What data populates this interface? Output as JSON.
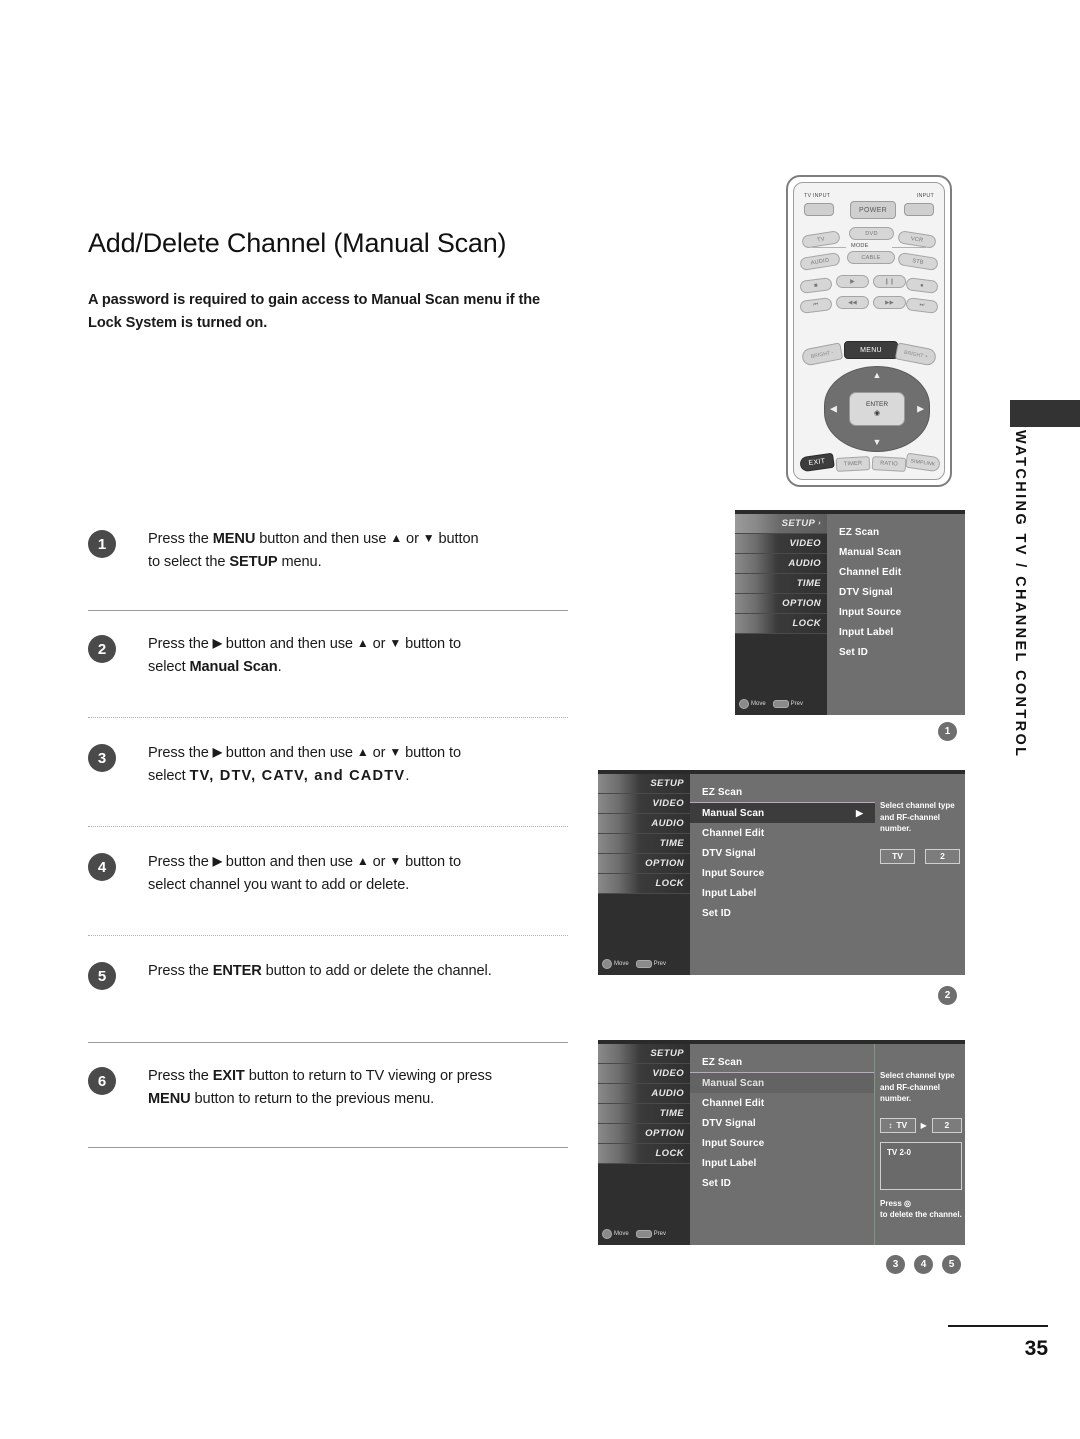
{
  "document": {
    "title": "Add/Delete Channel (Manual Scan)",
    "intro": "A password is required to gain access to Manual Scan menu if the Lock System is turned on.",
    "page_number": "35",
    "side_tab": "WATCHING TV / CHANNEL CONTROL"
  },
  "steps": [
    {
      "num": "1",
      "line1_a": "Press the ",
      "bold1": "MENU",
      "line1_b": " button and then use ",
      "up": "▲",
      "or": " or ",
      "down": "▼",
      "line1_c": " button",
      "line2_a": "to select the ",
      "bold2": "SETUP",
      "line2_b": " menu."
    },
    {
      "num": "2",
      "line1_a": "Press the ",
      "bold1": "▶",
      "line1_b": " button and then use ",
      "up": "▲",
      "or": " or ",
      "down": "▼",
      "line1_c": " button to",
      "line2_a": "select ",
      "bold2": "Manual Scan",
      "line2_b": "."
    },
    {
      "num": "3",
      "line1_a": "Press the ",
      "bold1": "▶",
      "line1_b": " button and then use ",
      "up": "▲",
      "or": " or ",
      "down": "▼",
      "line1_c": " button to",
      "line2_a": "select ",
      "bold2": "TV, DTV, CATV, and CADTV",
      "line2_b": "."
    },
    {
      "num": "4",
      "line1_a": "Press the ",
      "bold1": "▶",
      "line1_b": " button and then use ",
      "up": "▲",
      "or": " or ",
      "down": "▼",
      "line1_c": " button to",
      "line2_a": "select channel you want to add or delete.",
      "bold2": "",
      "line2_b": ""
    },
    {
      "num": "5",
      "line1_a": "Press the ",
      "bold1": "ENTER",
      "line1_b": " button to add or delete the channel.",
      "up": "",
      "or": "",
      "down": "",
      "line1_c": "",
      "line2_a": "",
      "bold2": "",
      "line2_b": ""
    },
    {
      "num": "6",
      "line1_a": "Press the ",
      "bold1": "EXIT",
      "line1_b": " button to return to TV viewing or press",
      "up": "",
      "or": "",
      "down": "",
      "line1_c": "",
      "line2_a": "",
      "bold2": "MENU",
      "line2_b": " button to return to the previous menu."
    }
  ],
  "remote": {
    "tv_input_label": "TV INPUT",
    "input_label": "INPUT",
    "power": "POWER",
    "mode_label": "MODE",
    "mode_row1": [
      "TV",
      "DVD",
      "VCR"
    ],
    "mode_row2": [
      "AUDIO",
      "CABLE",
      "STB"
    ],
    "transport_row1": [
      "■",
      "▶",
      "❙❙",
      "●"
    ],
    "transport_row2": [
      "⏮",
      "◀◀",
      "▶▶",
      "⏭"
    ],
    "bright_minus": "BRIGHT -",
    "bright_plus": "BRIGHT +",
    "menu": "MENU",
    "enter": "ENTER",
    "enter_glyph": "◉",
    "up_arrow": "▲",
    "down_arrow": "▼",
    "left_arrow": "◀",
    "right_arrow": "▶",
    "exit": "EXIT",
    "bottom_row": [
      "TIMER",
      "RATIO",
      "SIMPLINK"
    ]
  },
  "osd": {
    "sidebar": [
      {
        "label": "SETUP",
        "selected": true,
        "carat": "›"
      },
      {
        "label": "VIDEO",
        "selected": false,
        "carat": ""
      },
      {
        "label": "AUDIO",
        "selected": false,
        "carat": ""
      },
      {
        "label": "TIME",
        "selected": false,
        "carat": ""
      },
      {
        "label": "OPTION",
        "selected": false,
        "carat": ""
      },
      {
        "label": "LOCK",
        "selected": false,
        "carat": ""
      }
    ],
    "hints": {
      "move": "Move",
      "prev": "Prev"
    },
    "menu_items": [
      "EZ Scan",
      "Manual Scan",
      "Channel Edit",
      "DTV Signal",
      "Input Source",
      "Input Label",
      "Set ID"
    ],
    "screen1": {
      "selected_item": "",
      "marker": "1"
    },
    "screen2": {
      "selected_item": "Manual Scan",
      "arrow": "▶",
      "description": "Select channel type and RF-channel number.",
      "channel_type": "TV",
      "rf_channel": "2",
      "marker": "2"
    },
    "screen3": {
      "selected_item": "Manual Scan",
      "description": "Select channel type and RF-channel number.",
      "updown_glyph": "↕",
      "channel_type": "TV",
      "step_arrow": "▶",
      "rf_channel": "2",
      "channel_entry": "TV 2-0",
      "footer_line1": "Press ◎",
      "footer_line2": "to delete the channel.",
      "markers": [
        "3",
        "4",
        "5"
      ]
    }
  }
}
